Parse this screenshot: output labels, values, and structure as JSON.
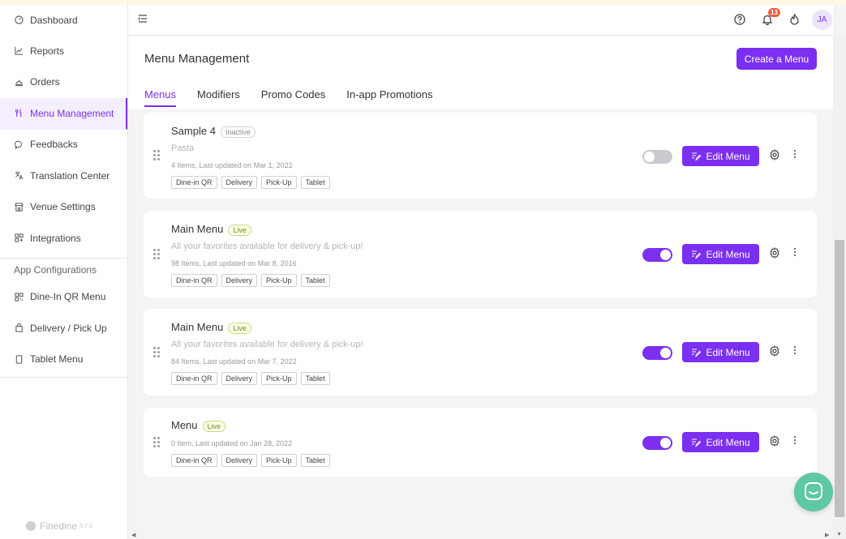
{
  "sidebar": {
    "items": [
      {
        "label": "Dashboard",
        "icon": "dashboard-icon"
      },
      {
        "label": "Reports",
        "icon": "chart-line-icon"
      },
      {
        "label": "Orders",
        "icon": "bell-service-icon"
      },
      {
        "label": "Menu Management",
        "icon": "fork-knife-icon",
        "active": true
      },
      {
        "label": "Feedbacks",
        "icon": "chat-icon"
      },
      {
        "label": "Translation Center",
        "icon": "translate-icon"
      },
      {
        "label": "Venue Settings",
        "icon": "store-icon"
      },
      {
        "label": "Integrations",
        "icon": "grid-plus-icon"
      }
    ],
    "section_title": "App Configurations",
    "config_items": [
      {
        "label": "Dine-In QR Menu",
        "icon": "qr-icon"
      },
      {
        "label": "Delivery / Pick Up",
        "icon": "bag-icon"
      },
      {
        "label": "Tablet Menu",
        "icon": "tablet-icon"
      }
    ],
    "brand_name": "Finedine",
    "brand_version": "3.7.3"
  },
  "header": {
    "notification_count": "13",
    "avatar_initials": "JA"
  },
  "page": {
    "title": "Menu Management",
    "create_button": "Create a Menu",
    "tabs": [
      {
        "label": "Menus",
        "active": true
      },
      {
        "label": "Modifiers"
      },
      {
        "label": "Promo Codes"
      },
      {
        "label": "In-app Promotions"
      }
    ]
  },
  "menus": [
    {
      "name": "Sample 4",
      "status": "Inactive",
      "description": "Pasta",
      "meta": "4 Items, Last updated on Mar 1, 2022",
      "chips": [
        "Dine-in QR",
        "Delivery",
        "Pick-Up",
        "Tablet"
      ],
      "enabled": false,
      "edit_label": "Edit Menu"
    },
    {
      "name": "Main Menu",
      "status": "Live",
      "description": "All your favorites available for delivery & pick-up!",
      "meta": "98 Items, Last updated on Mar 8, 2016",
      "chips": [
        "Dine-in QR",
        "Delivery",
        "Pick-Up",
        "Tablet"
      ],
      "enabled": true,
      "edit_label": "Edit Menu"
    },
    {
      "name": "Main Menu",
      "status": "Live",
      "description": "All your favorites available for delivery & pick-up!",
      "meta": "84 Items, Last updated on Mar 7, 2022",
      "chips": [
        "Dine-in QR",
        "Delivery",
        "Pick-Up",
        "Tablet"
      ],
      "enabled": true,
      "edit_label": "Edit Menu"
    },
    {
      "name": "Menu",
      "status": "Live",
      "description": "",
      "meta": "0 Item, Last updated on Jan 28, 2022",
      "chips": [
        "Dine-in QR",
        "Delivery",
        "Pick-Up",
        "Tablet"
      ],
      "enabled": true,
      "edit_label": "Edit Menu"
    }
  ],
  "colors": {
    "accent": "#7b2ff0",
    "live": "#6e8c1a",
    "chat_fab": "#5ec7a4"
  }
}
